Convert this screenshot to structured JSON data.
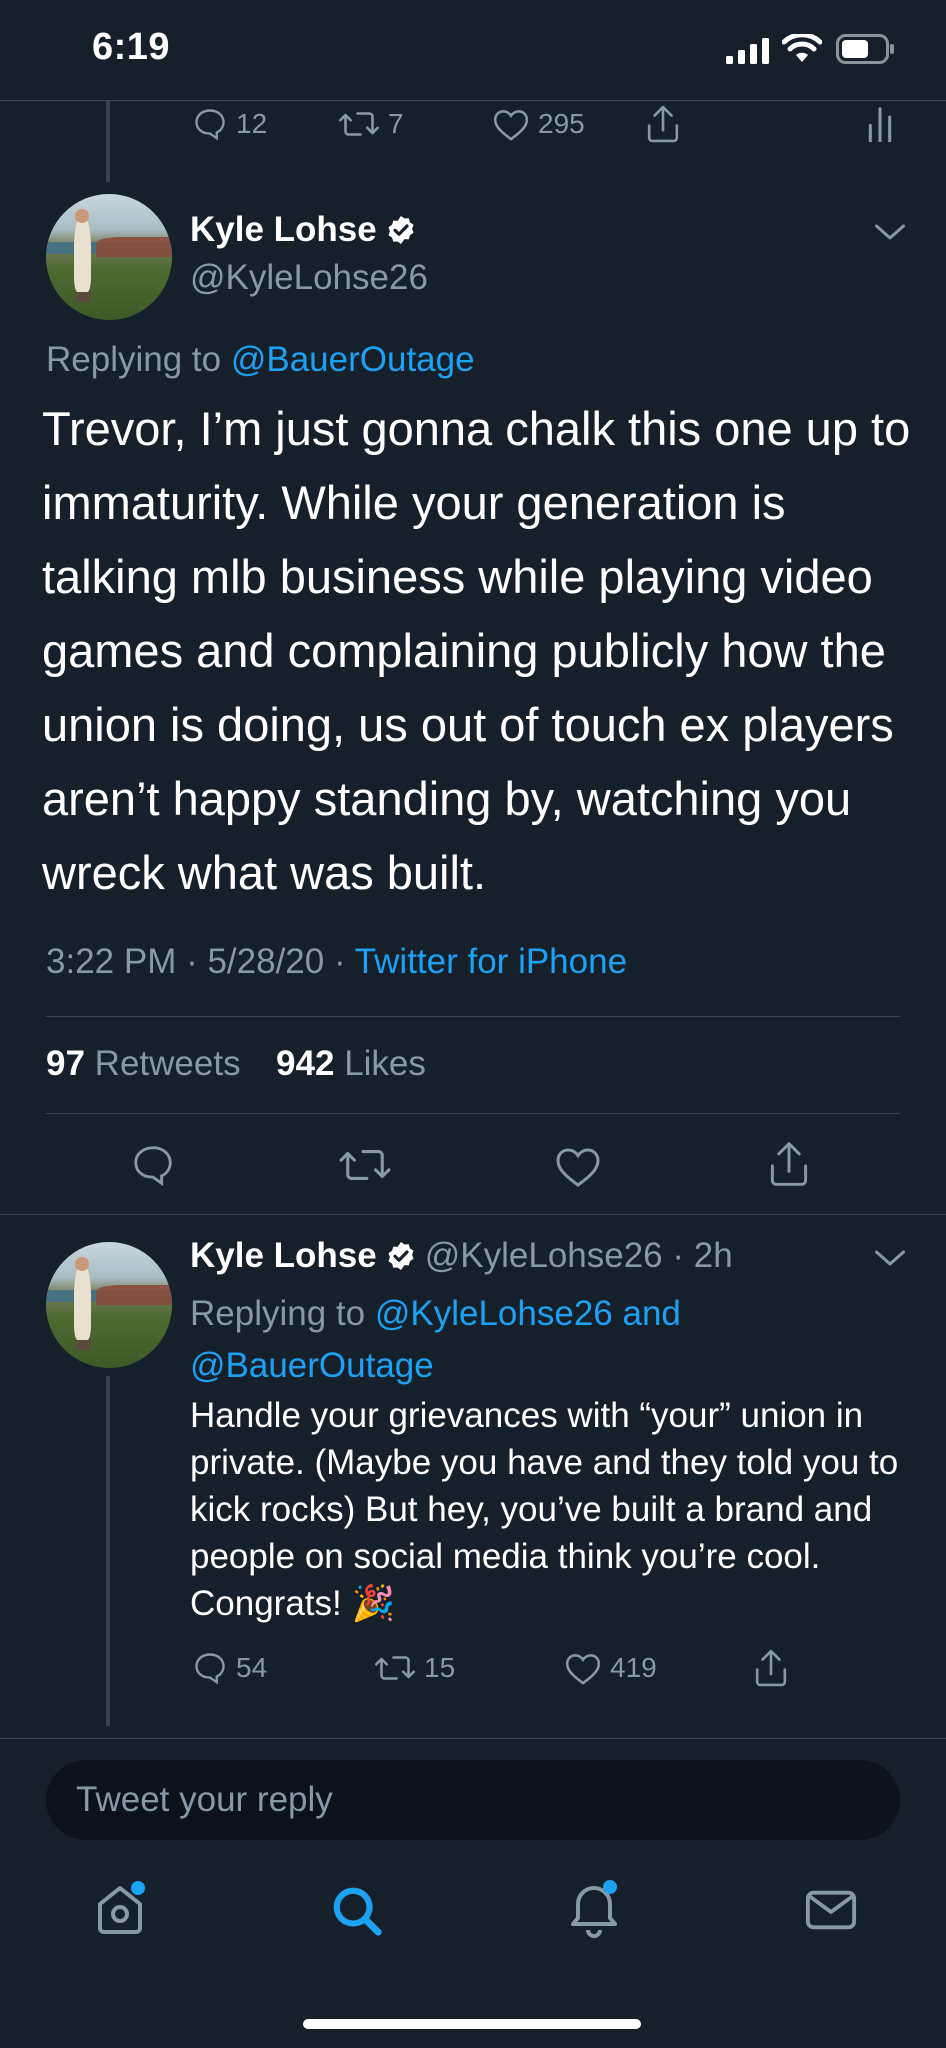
{
  "status_bar": {
    "time": "6:19"
  },
  "prev_tweet_actions": {
    "replies": "12",
    "retweets": "7",
    "likes": "295"
  },
  "main_tweet": {
    "author_name": "Kyle Lohse",
    "handle": "@KyleLohse26",
    "replying_prefix": "Replying to",
    "replying_to": "@BauerOutage",
    "text": "Trevor, I’m just gonna chalk this one up to immaturity. While your generation is talking mlb business while playing video games and complaining publicly how the union is doing, us out of touch ex players aren’t happy standing by, watching you wreck what was built.",
    "timestamp": "3:22 PM · 5/28/20 ·",
    "source": "Twitter for iPhone",
    "retweets_count": "97",
    "retweets_label": "Retweets",
    "likes_count": "942",
    "likes_label": "Likes"
  },
  "reply_tweet": {
    "author_name": "Kyle Lohse",
    "handle_time": "@KyleLohse26 · 2h",
    "replying_prefix": "Replying to",
    "replying_to_line1": "@KyleLohse26 and",
    "replying_to_line2": "@BauerOutage",
    "text": "Handle your grievances with “your” union in private. (Maybe you have and they told you to kick rocks) But hey, you’ve built a brand and people on social media think you’re cool. Congrats! 🎉",
    "replies": "54",
    "retweets": "15",
    "likes": "419"
  },
  "reply_input": {
    "placeholder": "Tweet your reply"
  },
  "colors": {
    "background": "#15202b",
    "accent": "#1da1f2",
    "muted": "#8899a6",
    "divider": "#38444d"
  },
  "tab_bar": {
    "icons": [
      "home-icon",
      "search-icon",
      "notifications-icon",
      "messages-icon"
    ],
    "active": "search-icon"
  }
}
